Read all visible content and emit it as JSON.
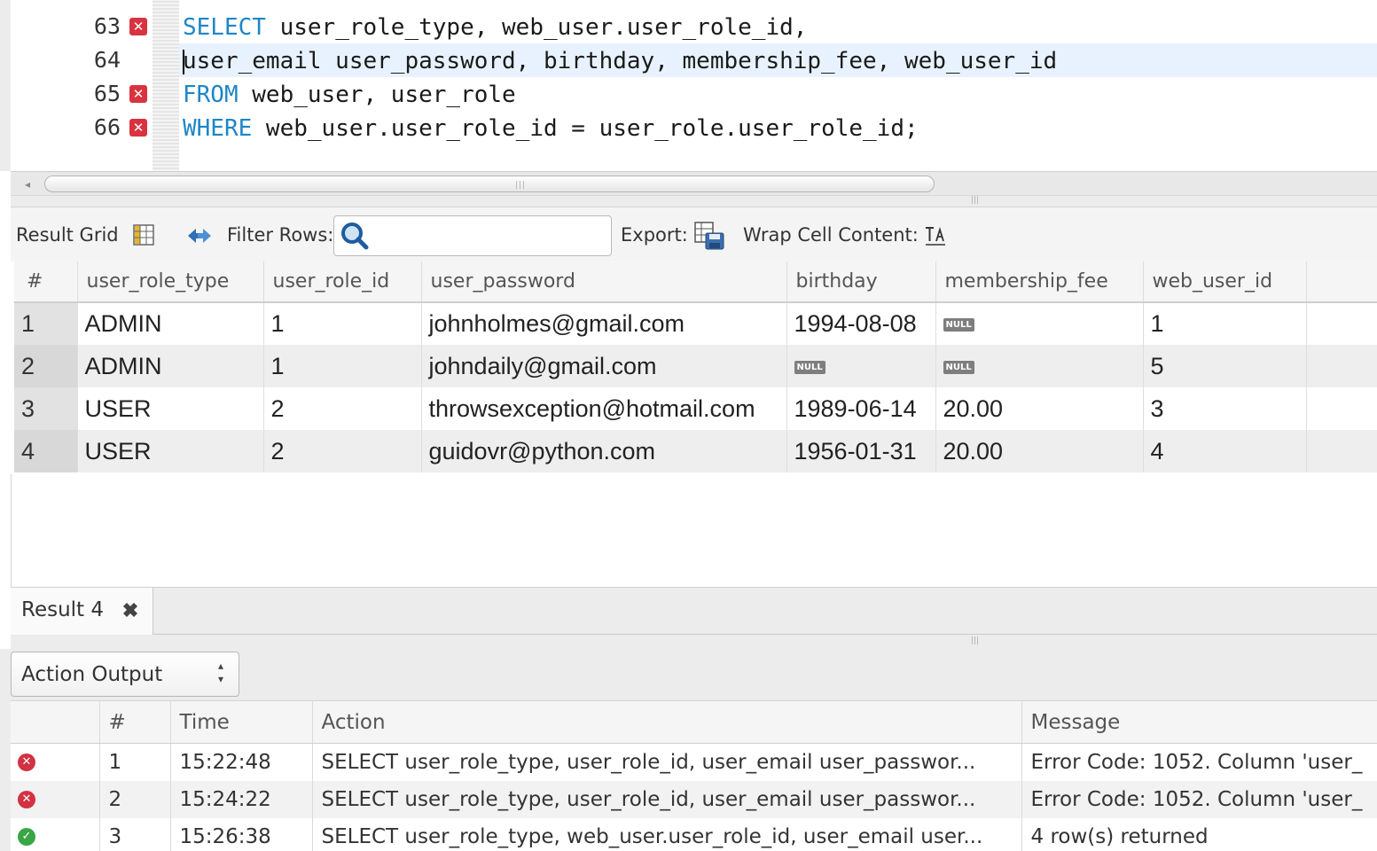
{
  "editor": {
    "lines": [
      {
        "num": "63",
        "has_error": true,
        "keyword": "SELECT",
        "rest": " user_role_type, web_user.user_role_id,",
        "current": false,
        "cursor": false
      },
      {
        "num": "64",
        "has_error": false,
        "keyword": "",
        "rest": "user_email user_password, birthday, membership_fee, web_user_id",
        "current": true,
        "cursor": true
      },
      {
        "num": "65",
        "has_error": true,
        "keyword": "FROM",
        "rest": " web_user, user_role",
        "current": false,
        "cursor": false
      },
      {
        "num": "66",
        "has_error": true,
        "keyword": "WHERE",
        "rest": " web_user.user_role_id = user_role.user_role_id;",
        "current": false,
        "cursor": false
      }
    ]
  },
  "toolbar": {
    "result_grid_label": "Result Grid",
    "filter_rows_label": "Filter Rows:",
    "filter_value": "",
    "export_label": "Export:",
    "wrap_label": "Wrap Cell Content:",
    "icons": {
      "grid": "grid-layout-icon",
      "refresh": "refresh-icon",
      "search": "search-icon",
      "export": "export-icon",
      "wrap": "wrap-cell-icon"
    }
  },
  "result": {
    "columns": [
      "#",
      "user_role_type",
      "user_role_id",
      "user_password",
      "birthday",
      "membership_fee",
      "web_user_id"
    ],
    "null_label": "NULL",
    "rows": [
      [
        "1",
        "ADMIN",
        "1",
        "johnholmes@gmail.com",
        "1994-08-08",
        null,
        "1"
      ],
      [
        "2",
        "ADMIN",
        "1",
        "johndaily@gmail.com",
        null,
        null,
        "5"
      ],
      [
        "3",
        "USER",
        "2",
        "throwsexception@hotmail.com",
        "1989-06-14",
        "20.00",
        "3"
      ],
      [
        "4",
        "USER",
        "2",
        "guidovr@python.com",
        "1956-01-31",
        "20.00",
        "4"
      ]
    ]
  },
  "tabs": [
    {
      "label": "Result 4",
      "close_icon": "close-icon"
    }
  ],
  "output": {
    "selector_label": "Action Output",
    "columns": [
      "",
      "#",
      "Time",
      "Action",
      "Message"
    ],
    "rows": [
      {
        "status": "error",
        "num": "1",
        "time": "15:22:48",
        "action": "SELECT user_role_type, user_role_id, user_email user_passwor...",
        "message": "Error Code: 1052. Column 'user_"
      },
      {
        "status": "error",
        "num": "2",
        "time": "15:24:22",
        "action": "SELECT user_role_type, user_role_id, user_email user_passwor...",
        "message": "Error Code: 1052. Column 'user_"
      },
      {
        "status": "ok",
        "num": "3",
        "time": "15:26:38",
        "action": "SELECT user_role_type, web_user.user_role_id, user_email user...",
        "message": "4 row(s) returned"
      }
    ]
  },
  "colors": {
    "keyword": "#1e86c7",
    "error_marker": "#d9333f",
    "current_line": "#e8f2fe",
    "status_error": "#d23242",
    "status_ok": "#3aa546"
  }
}
